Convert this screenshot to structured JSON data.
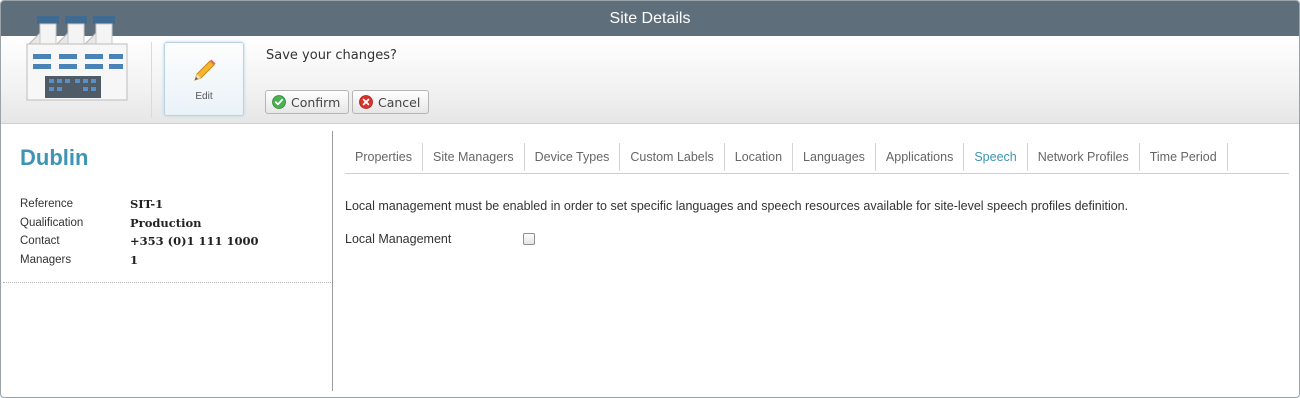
{
  "window": {
    "title": "Site Details"
  },
  "toolbar": {
    "edit_label": "Edit",
    "save_prompt": "Save your changes?",
    "confirm_label": "Confirm",
    "cancel_label": "Cancel"
  },
  "site": {
    "name": "Dublin",
    "fields": [
      {
        "label": "Reference",
        "value": "SIT-1"
      },
      {
        "label": "Qualification",
        "value": "Production"
      },
      {
        "label": "Contact",
        "value": "+353 (0)1 111 1000"
      },
      {
        "label": "Managers",
        "value": "1"
      }
    ]
  },
  "tabs": [
    {
      "label": "Properties",
      "active": false
    },
    {
      "label": "Site Managers",
      "active": false
    },
    {
      "label": "Device Types",
      "active": false
    },
    {
      "label": "Custom Labels",
      "active": false
    },
    {
      "label": "Location",
      "active": false
    },
    {
      "label": "Languages",
      "active": false
    },
    {
      "label": "Applications",
      "active": false
    },
    {
      "label": "Speech",
      "active": true
    },
    {
      "label": "Network Profiles",
      "active": false
    },
    {
      "label": "Time Period",
      "active": false
    }
  ],
  "speech": {
    "notice": "Local management must be enabled in order to set specific languages and speech resources available for site-level speech profiles definition.",
    "local_management_label": "Local Management",
    "local_management_checked": false
  },
  "colors": {
    "titlebar": "#5e6e7b",
    "accent": "#3d95b3",
    "confirm_green": "#4caf50",
    "cancel_red": "#d9342b"
  },
  "icons": [
    "factory-icon",
    "pencil-icon",
    "check-circle-icon",
    "x-circle-icon"
  ]
}
